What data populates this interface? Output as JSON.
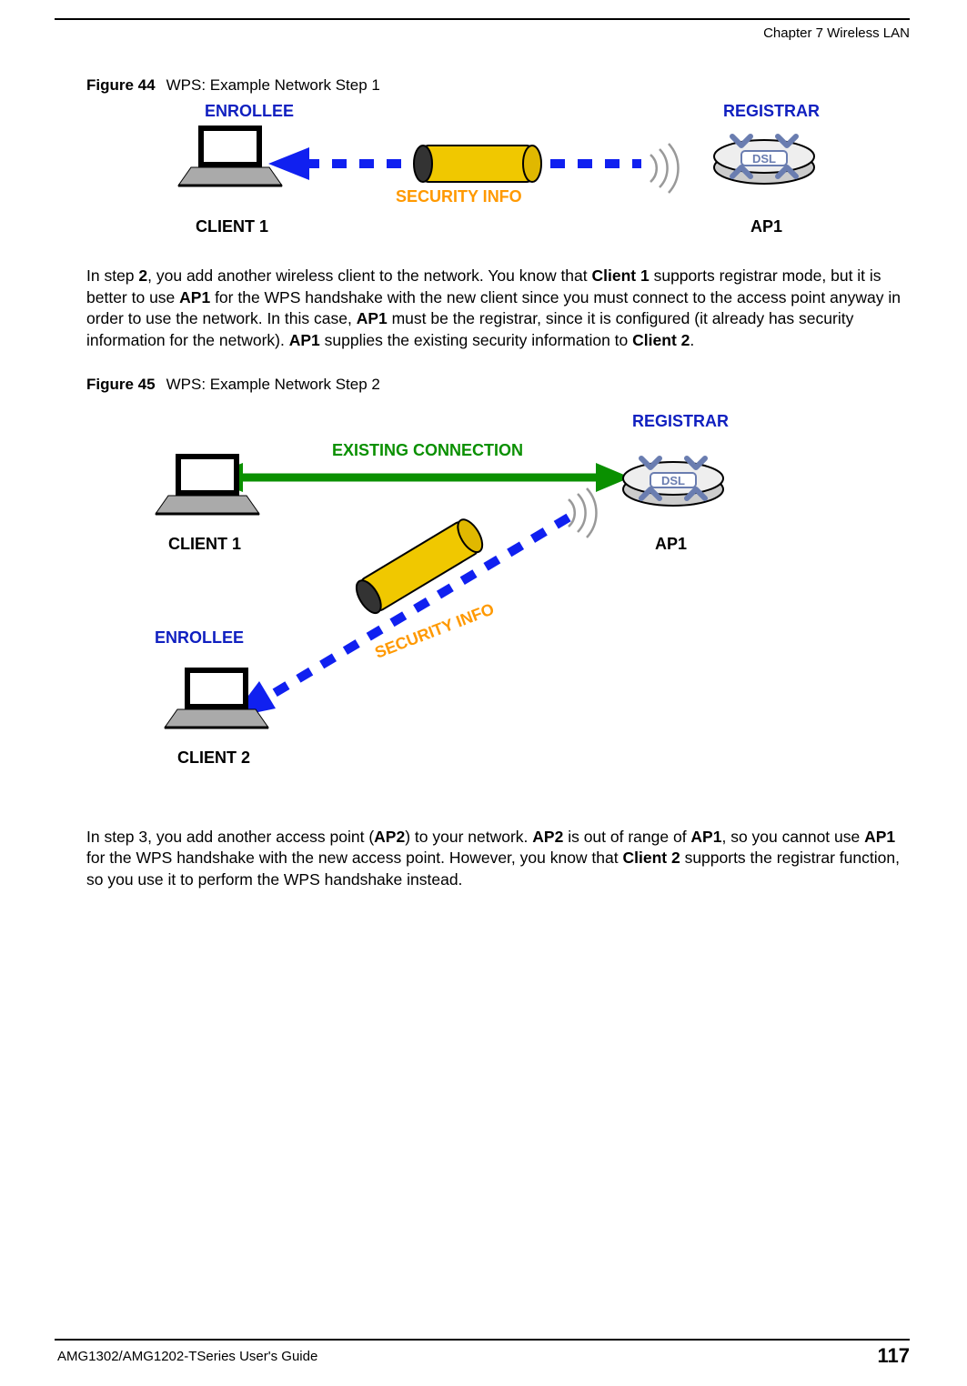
{
  "header": {
    "chapter": "Chapter 7 Wireless LAN"
  },
  "figure44": {
    "caption_prefix": "Figure 44",
    "caption_text": "WPS: Example Network Step 1",
    "enrollee": "ENROLLEE",
    "registrar": "REGISTRAR",
    "security_info": "SECURITY INFO",
    "client1": "CLIENT 1",
    "ap1": "AP1",
    "router_text": "DSL"
  },
  "paragraph1": {
    "seg1": "In step ",
    "b1": "2",
    "seg2": ", you add another wireless client to the network. You know that ",
    "b2": "Client 1",
    "seg3": " supports registrar mode, but it is better to use ",
    "b3": "AP1",
    "seg4": " for the WPS handshake with the new client since you must connect to the access point anyway in order to use the network. In this case, ",
    "b4": "AP1",
    "seg5": " must be the registrar, since it is configured (it already has security information for the network). ",
    "b5": "AP1",
    "seg6": " supplies the existing security information to ",
    "b6": "Client 2",
    "seg7": "."
  },
  "figure45": {
    "caption_prefix": "Figure 45",
    "caption_text": "WPS: Example Network Step 2",
    "registrar": "REGISTRAR",
    "existing_connection": "EXISTING CONNECTION",
    "client1": "CLIENT 1",
    "ap1": "AP1",
    "enrollee": "ENROLLEE",
    "security_info": "SECURITY INFO",
    "client2": "CLIENT 2",
    "router_text": "DSL"
  },
  "paragraph2": {
    "seg1": "In step 3, you add another access point (",
    "b1": "AP2",
    "seg2": ") to your network. ",
    "b2": "AP2",
    "seg3": " is out of range of ",
    "b3": "AP1",
    "seg4": ", so you cannot use ",
    "b4": "AP1",
    "seg5": " for the WPS handshake with the new access point. However, you know that ",
    "b5": "Client 2",
    "seg6": " supports the registrar function, so you use it to perform the WPS handshake instead."
  },
  "footer": {
    "guide": "AMG1302/AMG1202-TSeries User's Guide",
    "page": "117"
  }
}
